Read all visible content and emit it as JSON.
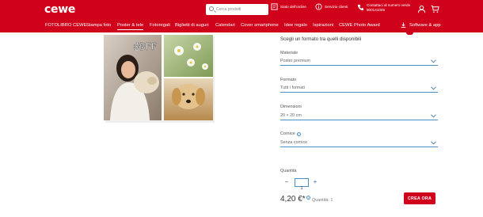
{
  "brand": {
    "logo": "cewe",
    "color": "#d0021b"
  },
  "search": {
    "placeholder": "Cerca prodotti"
  },
  "header_tools": {
    "order_status": "Stato dell'ordine",
    "service": "Servizio clienti",
    "phone_line1": "Contattaci al numero verde",
    "phone_line2": "800141005"
  },
  "nav": {
    "items": [
      "FOTOLIBRO CEWE",
      "Stampa foto",
      "Poster & tele",
      "Fotoregali",
      "Biglietti di auguri",
      "Calendari",
      "Cover smartphone",
      "Idee regalo",
      "Ispirazioni",
      "CEWE Photo Award"
    ],
    "active_index": 2,
    "software": "Software & app"
  },
  "product_image": {
    "overlay_text": "#BFF"
  },
  "config": {
    "subtitle": "Scegli un formato tra quelli disponibili",
    "fields": [
      {
        "label": "Materiale",
        "value": "Poster premium"
      },
      {
        "label": "Formato",
        "value": "Tutti i formati"
      },
      {
        "label": "Dimensioni",
        "value": "20 × 20 cm"
      },
      {
        "label": "Cornice",
        "value": "Senza cornice"
      }
    ],
    "quantity_label": "Quantità",
    "quantity_value": "1",
    "price": "4,20 €*",
    "quantity_note": "Quantità: 1",
    "cta": "CREA ORA"
  }
}
